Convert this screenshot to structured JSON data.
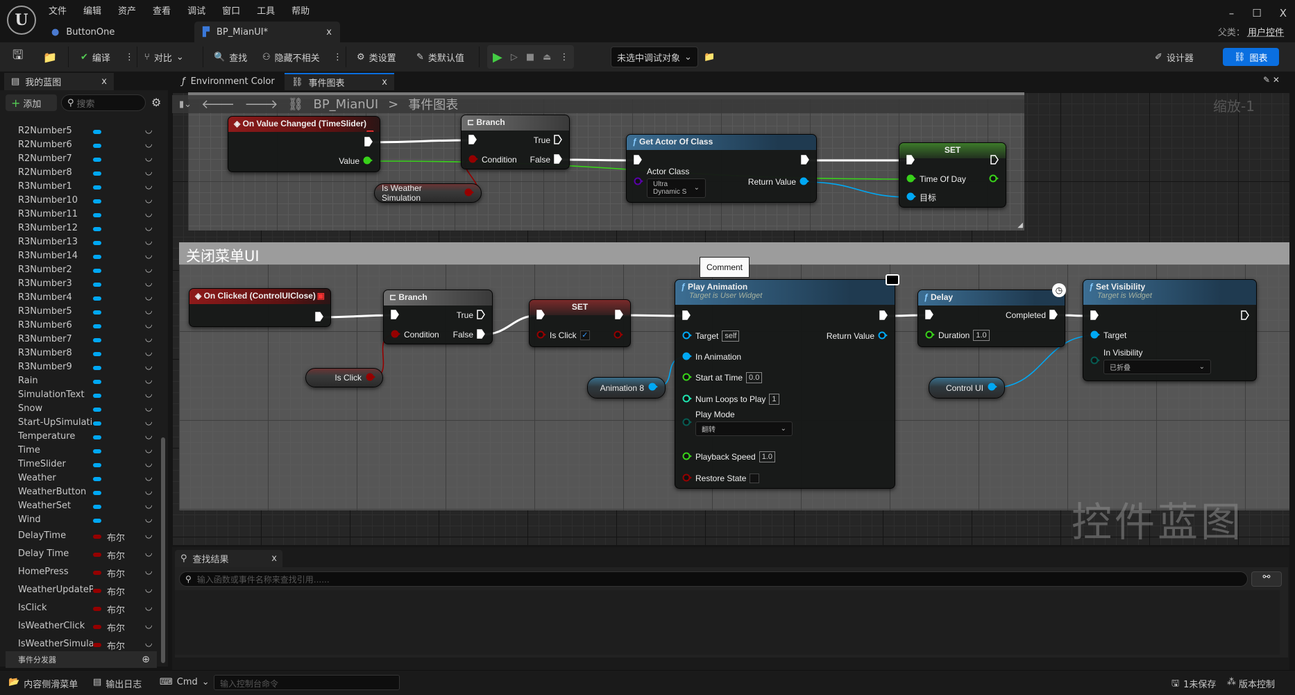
{
  "menu": [
    "文件",
    "编辑",
    "资产",
    "查看",
    "调试",
    "窗口",
    "工具",
    "帮助"
  ],
  "doc_tabs": [
    {
      "label": "ButtonOne",
      "icon": "widget-icon"
    },
    {
      "label": "BP_MianUI*",
      "icon": "blueprint-icon",
      "close": "x"
    }
  ],
  "window": {
    "minimize": "–",
    "maximize": "☐",
    "close": "X",
    "parent_label": "父类：",
    "parent_value": "用户控件"
  },
  "toolbar": {
    "compile": "编译",
    "diff": "对比",
    "find": "查找",
    "hide_unrelated": "隐藏不相关",
    "class_settings": "类设置",
    "class_defaults": "类默认值",
    "debug_target": "未选中调试对象",
    "designer": "设计器",
    "graph": "图表",
    "more": "⋮"
  },
  "panel_tabs": {
    "my_blueprint": "我的蓝图",
    "environment_color": "Environment Color",
    "event_graph": "事件图表",
    "close": "x"
  },
  "sidebar": {
    "add": "添加",
    "search_placeholder": "搜索",
    "event_dispatchers": "事件分发器",
    "items": [
      {
        "name": "R2Number5",
        "type": "widget"
      },
      {
        "name": "R2Number6",
        "type": "widget"
      },
      {
        "name": "R2Number7",
        "type": "widget"
      },
      {
        "name": "R2Number8",
        "type": "widget"
      },
      {
        "name": "R3Number1",
        "type": "widget"
      },
      {
        "name": "R3Number10",
        "type": "widget"
      },
      {
        "name": "R3Number11",
        "type": "widget"
      },
      {
        "name": "R3Number12",
        "type": "widget"
      },
      {
        "name": "R3Number13",
        "type": "widget"
      },
      {
        "name": "R3Number14",
        "type": "widget"
      },
      {
        "name": "R3Number2",
        "type": "widget"
      },
      {
        "name": "R3Number3",
        "type": "widget"
      },
      {
        "name": "R3Number4",
        "type": "widget"
      },
      {
        "name": "R3Number5",
        "type": "widget"
      },
      {
        "name": "R3Number6",
        "type": "widget"
      },
      {
        "name": "R3Number7",
        "type": "widget"
      },
      {
        "name": "R3Number8",
        "type": "widget"
      },
      {
        "name": "R3Number9",
        "type": "widget"
      },
      {
        "name": "Rain",
        "type": "widget"
      },
      {
        "name": "SimulationText",
        "type": "widget"
      },
      {
        "name": "Snow",
        "type": "widget"
      },
      {
        "name": "Start-UpSimulatio",
        "type": "widget"
      },
      {
        "name": "Temperature",
        "type": "widget"
      },
      {
        "name": "Time",
        "type": "widget"
      },
      {
        "name": "TimeSlider",
        "type": "widget"
      },
      {
        "name": "Weather",
        "type": "widget"
      },
      {
        "name": "WeatherButton",
        "type": "widget"
      },
      {
        "name": "WeatherSet",
        "type": "widget"
      },
      {
        "name": "Wind",
        "type": "widget"
      },
      {
        "name": "DelayTime",
        "type": "bool",
        "type_label": "布尔"
      },
      {
        "name": "Delay Time",
        "type": "bool",
        "type_label": "布尔"
      },
      {
        "name": "HomePress",
        "type": "bool",
        "type_label": "布尔"
      },
      {
        "name": "WeatherUpdatePa",
        "type": "bool",
        "type_label": "布尔"
      },
      {
        "name": "IsClick",
        "type": "bool",
        "type_label": "布尔"
      },
      {
        "name": "IsWeatherClick",
        "type": "bool",
        "type_label": "布尔"
      },
      {
        "name": "IsWeatherSimulat",
        "type": "bool",
        "type_label": "布尔"
      }
    ]
  },
  "graph": {
    "breadcrumb": {
      "blueprint": "BP_MianUI",
      "separator": ">",
      "graph": "事件图表"
    },
    "zoom": "缩放-1",
    "comment_bottom": "关闭菜单UI",
    "comment_tooltip": "Comment",
    "watermark": "控件蓝图",
    "nodes": [
      {
        "kind": "event",
        "title": "On Value Changed (TimeSlider)",
        "rows": [
          [
            null,
            {
              "type": "exec",
              "connected": true
            }
          ],
          [
            null,
            {
              "label": "Value",
              "type": "float",
              "connected": true
            }
          ]
        ]
      },
      {
        "kind": "branch",
        "title": "Branch",
        "rows": [
          [
            {
              "type": "exec",
              "connected": true
            },
            {
              "label": "True",
              "type": "exec",
              "connected": false
            }
          ],
          [
            {
              "label": "Condition",
              "type": "bool",
              "connected": true
            },
            {
              "label": "False",
              "type": "exec",
              "connected": true
            }
          ]
        ]
      },
      {
        "kind": "var",
        "title": "Is Weather Simulation",
        "pin": {
          "type": "bool",
          "connected": true
        }
      },
      {
        "kind": "func",
        "title": "Get Actor Of Class",
        "rows": [
          [
            {
              "type": "exec",
              "connected": true
            },
            {
              "type": "exec",
              "connected": true
            }
          ],
          [
            {
              "label": "Actor Class",
              "type": "class",
              "connected": false,
              "dropdown": "Ultra Dynamic S"
            },
            {
              "label": "Return Value",
              "type": "object",
              "connected": true
            }
          ]
        ]
      },
      {
        "kind": "set",
        "title": "SET",
        "rows": [
          [
            {
              "type": "exec",
              "connected": true
            },
            {
              "type": "exec",
              "connected": false
            }
          ],
          [
            {
              "label": "Time Of Day",
              "type": "float",
              "connected": true
            },
            {
              "type": "float",
              "connected": false
            }
          ],
          [
            {
              "label": "目标",
              "type": "object",
              "connected": true
            },
            null
          ]
        ]
      },
      {
        "kind": "event",
        "title": "On Clicked (ControlUIClose)",
        "rows": [
          [
            null,
            {
              "type": "exec",
              "connected": true
            }
          ]
        ]
      },
      {
        "kind": "branch",
        "title": "Branch",
        "rows": [
          [
            {
              "type": "exec",
              "connected": true
            },
            {
              "label": "True",
              "type": "exec",
              "connected": false
            }
          ],
          [
            {
              "label": "Condition",
              "type": "bool",
              "connected": true
            },
            {
              "label": "False",
              "type": "exec",
              "connected": true
            }
          ]
        ]
      },
      {
        "kind": "var",
        "title": "Is Click",
        "pin": {
          "type": "bool",
          "connected": true
        }
      },
      {
        "kind": "setbool",
        "title": "SET",
        "rows": [
          [
            {
              "type": "exec",
              "connected": true
            },
            {
              "type": "exec",
              "connected": true
            }
          ],
          [
            {
              "label": "Is Click",
              "type": "bool",
              "connected": false,
              "checkbox": true
            },
            {
              "type": "bool",
              "connected": false
            }
          ]
        ]
      },
      {
        "kind": "varobj",
        "title": "Animation 8",
        "pin": {
          "type": "object",
          "connected": true
        }
      },
      {
        "kind": "func",
        "title": "Play Animation",
        "subtitle": "Target is User Widget",
        "rows": [
          [
            {
              "type": "exec",
              "connected": true
            },
            {
              "type": "exec",
              "connected": true
            }
          ],
          [
            {
              "label": "Target",
              "type": "object",
              "connected": false,
              "value": "self"
            },
            {
              "label": "Return Value",
              "type": "object",
              "connected": false
            }
          ],
          [
            {
              "label": "In Animation",
              "type": "object",
              "connected": true
            },
            null
          ],
          [
            {
              "label": "Start at Time",
              "type": "float",
              "connected": false,
              "value": "0.0"
            },
            null
          ],
          [
            {
              "label": "Num Loops to Play",
              "type": "int",
              "connected": false,
              "value": "1"
            },
            null
          ],
          [
            {
              "label": "Play Mode",
              "type": "enum",
              "connected": false,
              "dropdown": "翻转"
            },
            null
          ],
          [
            {
              "label": "Playback Speed",
              "type": "float",
              "connected": false,
              "value": "1.0"
            },
            null
          ],
          [
            {
              "label": "Restore State",
              "type": "bool",
              "connected": false,
              "checkbox": false
            },
            null
          ]
        ]
      },
      {
        "kind": "func",
        "title": "Delay",
        "rows": [
          [
            {
              "type": "exec",
              "connected": true
            },
            {
              "label": "Completed",
              "type": "exec",
              "connected": true
            }
          ],
          [
            {
              "label": "Duration",
              "type": "float",
              "connected": false,
              "value": "1.0"
            },
            null
          ]
        ]
      },
      {
        "kind": "varobj",
        "title": "Control UI",
        "pin": {
          "type": "object",
          "connected": true
        }
      },
      {
        "kind": "func",
        "title": "Set Visibility",
        "subtitle": "Target is Widget",
        "rows": [
          [
            {
              "type": "exec",
              "connected": true
            },
            {
              "type": "exec",
              "connected": false
            }
          ],
          [
            {
              "label": "Target",
              "type": "object",
              "connected": true
            },
            null
          ],
          [
            {
              "label": "In Visibility",
              "type": "enum",
              "connected": false,
              "dropdown": "已折叠"
            },
            null
          ]
        ]
      }
    ]
  },
  "pin_colors": {
    "exec": "#ffffff",
    "bool": "#950000",
    "float": "#38d11a",
    "object": "#00a8f4",
    "class": "#5800a8",
    "int": "#1fe3af",
    "enum": "#075b52"
  },
  "find_results": {
    "tab": "查找结果",
    "close": "x",
    "placeholder": "输入函数或事件名称来查找引用......"
  },
  "statusbar": {
    "content_drawer": "内容侧滑菜单",
    "output_log": "输出日志",
    "cmd": "Cmd",
    "console_placeholder": "输入控制台命令",
    "unsaved": "1未保存",
    "source_control": "版本控制"
  },
  "accent": "#0a6fe0"
}
